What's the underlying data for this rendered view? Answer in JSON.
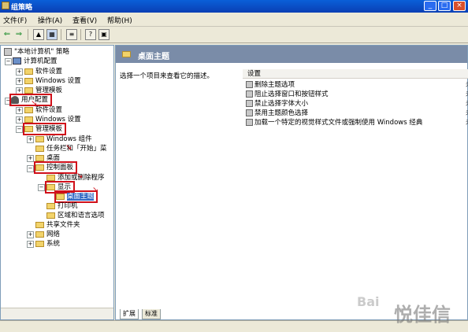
{
  "window": {
    "title": "组策略"
  },
  "menu": [
    "文件(F)",
    "操作(A)",
    "查看(V)",
    "帮助(H)"
  ],
  "toolbar_icons": [
    "back-arrow-icon",
    "forward-arrow-icon",
    "up-folder-icon",
    "show-tree-icon",
    "export-icon",
    "help-icon",
    "properties-icon"
  ],
  "tree": [
    {
      "label": "\"本地计算机\" 策略",
      "icon": "policy"
    },
    {
      "label": "计算机配置",
      "icon": "pc"
    },
    {
      "label": "软件设置",
      "icon": "folder"
    },
    {
      "label": "Windows 设置",
      "icon": "folder"
    },
    {
      "label": "管理模板",
      "icon": "folder"
    },
    {
      "label": "用户配置",
      "icon": "user"
    },
    {
      "label": "软件设置",
      "icon": "folder"
    },
    {
      "label": "Windows 设置",
      "icon": "folder"
    },
    {
      "label": "管理模板",
      "icon": "folder"
    },
    {
      "label": "Windows 组件",
      "icon": "folder"
    },
    {
      "label": "任务栏和「开始」菜",
      "icon": "folder"
    },
    {
      "label": "桌面",
      "icon": "folder"
    },
    {
      "label": "控制面板",
      "icon": "folder"
    },
    {
      "label": "添加或删除程序",
      "icon": "folder"
    },
    {
      "label": "显示",
      "icon": "folder"
    },
    {
      "label": "桌面主题",
      "icon": "folder"
    },
    {
      "label": "打印机",
      "icon": "folder"
    },
    {
      "label": "区域和语言选项",
      "icon": "folder"
    },
    {
      "label": "共享文件夹",
      "icon": "folder"
    },
    {
      "label": "网络",
      "icon": "folder"
    },
    {
      "label": "系统",
      "icon": "folder"
    }
  ],
  "right": {
    "header": "桌面主题",
    "description": "选择一个项目来查看它的描述。",
    "column": "设置",
    "items": [
      "删除主题选项",
      "阻止选择窗口和按钮样式",
      "禁止选择字体大小",
      "禁用主题颜色选择",
      "加载一个特定的视觉样式文件或强制使用 Windows 经典"
    ],
    "trunc": "未"
  },
  "tabs": [
    "扩展",
    "标准"
  ],
  "watermark": "悦佳信",
  "baidu_mark": "Bai"
}
